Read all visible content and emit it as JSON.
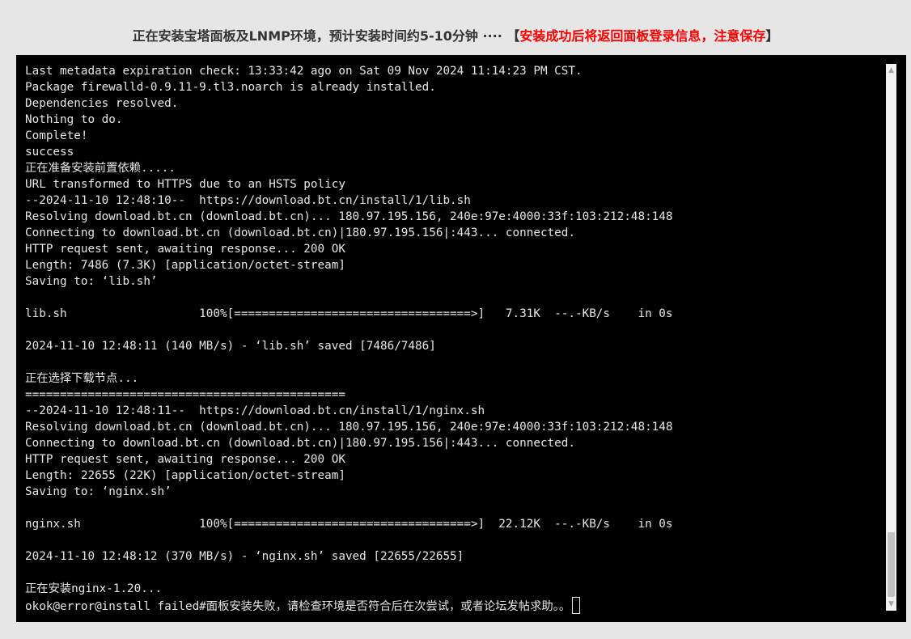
{
  "header": {
    "main_text": "正在安装宝塔面板及LNMP环境，预计安装时间约5-10分钟 ···· ",
    "bracket_open": "【",
    "warning_text": "安装成功后将返回面板登录信息，注意保存",
    "bracket_close": "】",
    "warning_color": "#ff0000"
  },
  "terminal": {
    "lines": [
      "Last metadata expiration check: 13:33:42 ago on Sat 09 Nov 2024 11:14:23 PM CST.",
      "Package firewalld-0.9.11-9.tl3.noarch is already installed.",
      "Dependencies resolved.",
      "Nothing to do.",
      "Complete!",
      "success",
      "正在准备安装前置依赖.....",
      "URL transformed to HTTPS due to an HSTS policy",
      "--2024-11-10 12:48:10--  https://download.bt.cn/install/1/lib.sh",
      "Resolving download.bt.cn (download.bt.cn)... 180.97.195.156, 240e:97e:4000:33f:103:212:48:148",
      "Connecting to download.bt.cn (download.bt.cn)|180.97.195.156|:443... connected.",
      "HTTP request sent, awaiting response... 200 OK",
      "Length: 7486 (7.3K) [application/octet-stream]",
      "Saving to: ‘lib.sh’",
      "",
      "lib.sh                   100%[==================================>]   7.31K  --.-KB/s    in 0s",
      "",
      "2024-11-10 12:48:11 (140 MB/s) - ‘lib.sh’ saved [7486/7486]",
      "",
      "正在选择下载节点...",
      "==============================================",
      "--2024-11-10 12:48:11--  https://download.bt.cn/install/1/nginx.sh",
      "Resolving download.bt.cn (download.bt.cn)... 180.97.195.156, 240e:97e:4000:33f:103:212:48:148",
      "Connecting to download.bt.cn (download.bt.cn)|180.97.195.156|:443... connected.",
      "HTTP request sent, awaiting response... 200 OK",
      "Length: 22655 (22K) [application/octet-stream]",
      "Saving to: ‘nginx.sh’",
      "",
      "nginx.sh                 100%[==================================>]  22.12K  --.-KB/s    in 0s",
      "",
      "2024-11-10 12:48:12 (370 MB/s) - ‘nginx.sh’ saved [22655/22655]",
      "",
      "正在安装nginx-1.20...",
      "okok@error@install failed#面板安装失败，请检查环境是否符合后在次尝试，或者论坛发帖求助。。"
    ]
  },
  "scrollbar": {
    "up_icon": "▲",
    "down_icon": "▼"
  }
}
